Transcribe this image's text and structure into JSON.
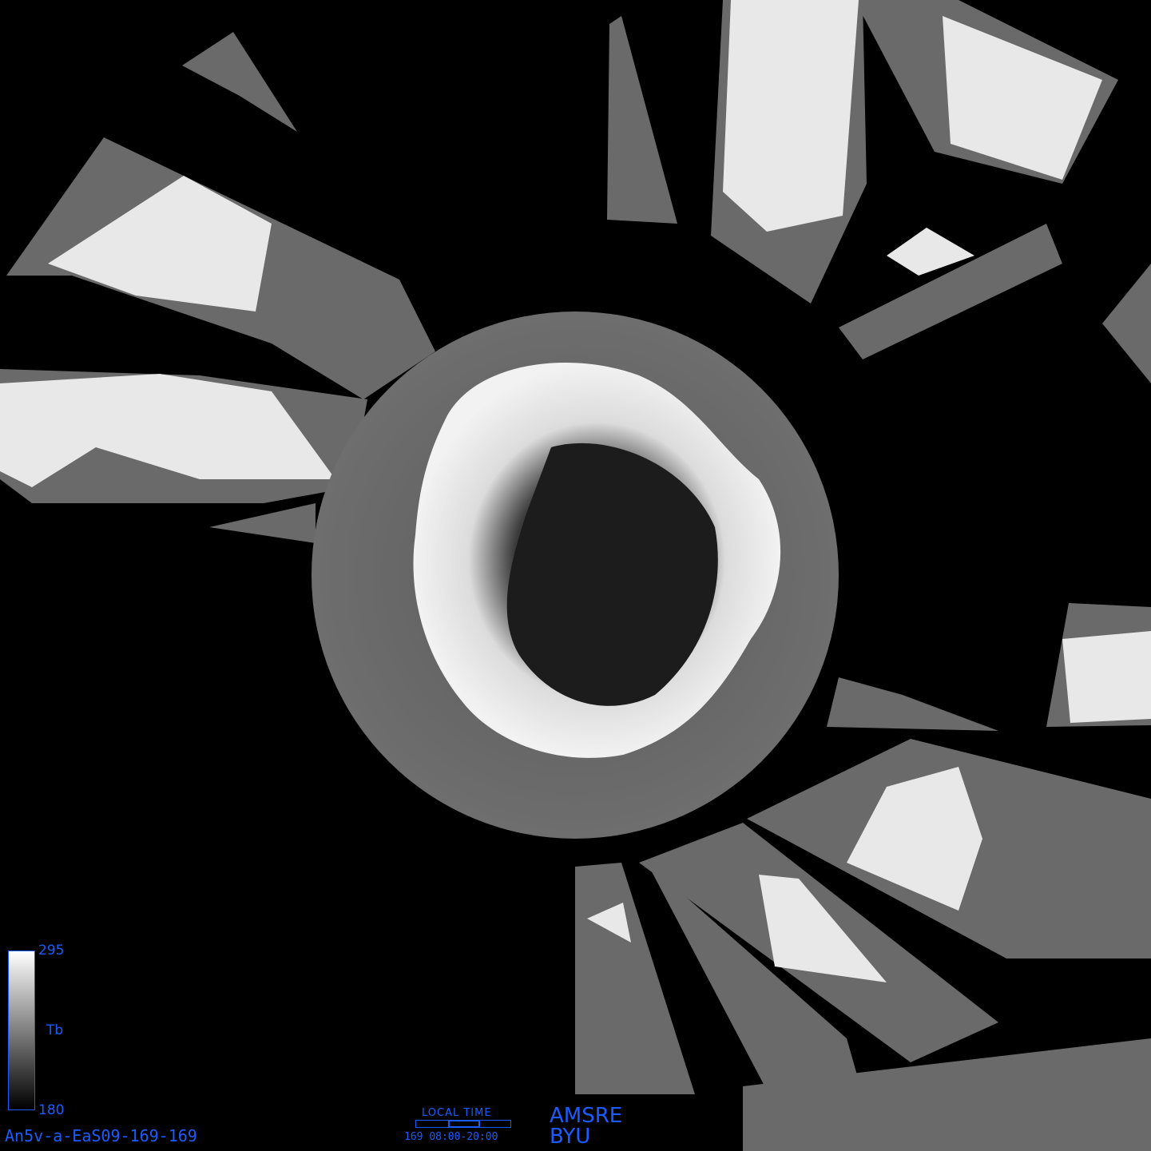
{
  "product_id": "An5v-a-EaS09-169-169",
  "colorbar": {
    "max": "295",
    "min": "180",
    "variable": "Tb"
  },
  "local_time": {
    "heading": "LOCAL TIME",
    "day": "169",
    "range": "08:00-20:00"
  },
  "credit": {
    "sensor": "AMSRE",
    "org": "BYU"
  }
}
